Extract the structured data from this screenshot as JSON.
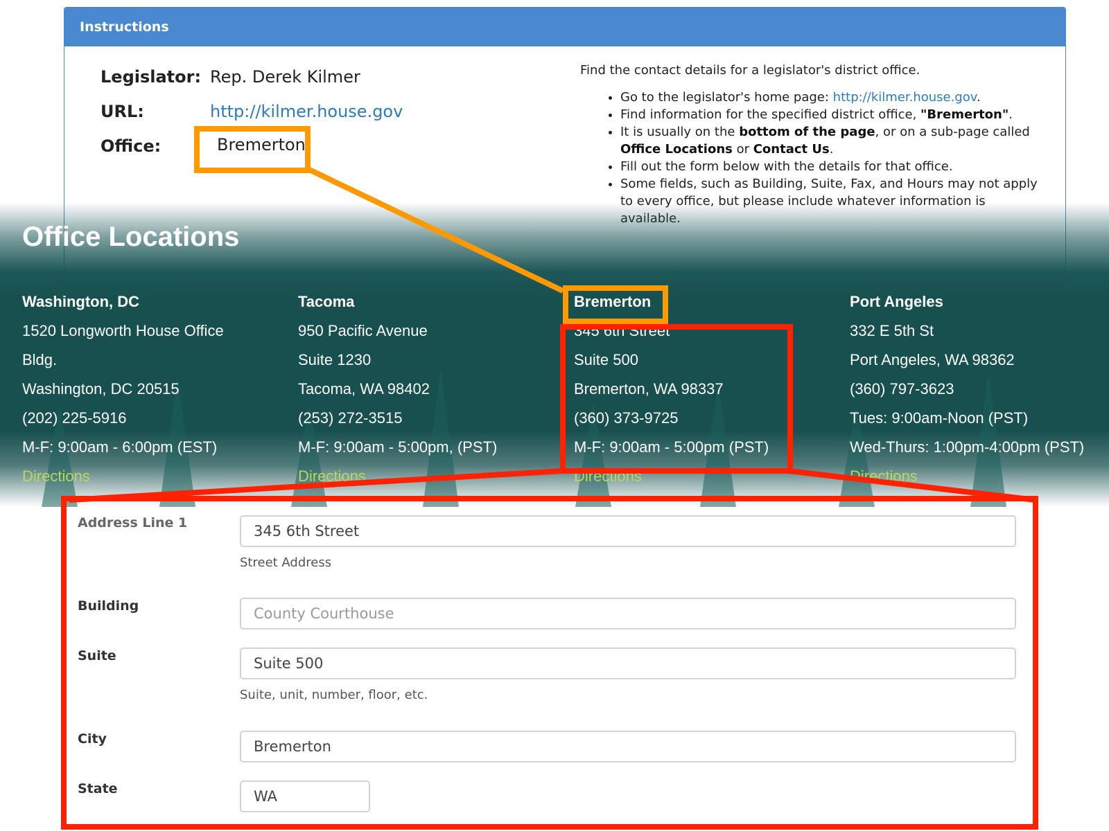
{
  "instructions": {
    "header": "Instructions",
    "legislator_label": "Legislator:",
    "legislator_value": "Rep. Derek Kilmer",
    "url_label": "URL:",
    "url_value": "http://kilmer.house.gov",
    "office_label": "Office:",
    "office_value": "Bremerton",
    "intro": "Find the contact details for a legislator's district office.",
    "bullets": {
      "b1_text": "Go to the legislator's home page: ",
      "b1_link": "http://kilmer.house.gov",
      "b1_end": ".",
      "b2_text": "Find information for the specified district office, ",
      "b2_bold": "\"Bremerton\"",
      "b2_end": ".",
      "b3_text": "It is usually on the ",
      "b3_bold1": "bottom of the page",
      "b3_mid": ", or on a sub-page called ",
      "b3_bold2": "Office Locations",
      "b3_or": " or ",
      "b3_bold3": "Contact Us",
      "b3_end": ".",
      "b4_text": "Fill out the form below with the details for that office.",
      "b5_text": "Some fields, such as Building, Suite, Fax, and Hours may not apply to every office, but please include whatever information is available."
    }
  },
  "office_locations": {
    "title": "Office Locations",
    "offices": [
      {
        "name": "Washington, DC",
        "line1": "1520 Longworth House Office",
        "line2": "Bldg.",
        "line3": "Washington, DC 20515",
        "line4": "(202) 225-5916",
        "line5": "M-F: 9:00am - 6:00pm (EST)",
        "directions": "Directions"
      },
      {
        "name": "Tacoma",
        "line1": "950 Pacific Avenue",
        "line2": "Suite 1230",
        "line3": "Tacoma, WA 98402",
        "line4": "(253) 272-3515",
        "line5": "M-F: 9:00am - 5:00pm, (PST)",
        "directions": "Directions"
      },
      {
        "name": "Bremerton",
        "line1": "345 6th Street",
        "line2": "Suite 500",
        "line3": "Bremerton, WA 98337",
        "line4": "(360) 373-9725",
        "line5": "M-F: 9:00am - 5:00pm (PST)",
        "directions": "Directions"
      },
      {
        "name": "Port Angeles",
        "line1": "332 E 5th St",
        "line2": "Port Angeles, WA 98362",
        "line3": "(360) 797-3623",
        "line4": "Tues: 9:00am-Noon (PST)",
        "line5": "Wed-Thurs: 1:00pm-4:00pm (PST)",
        "directions": "Directions"
      }
    ]
  },
  "form": {
    "address1_label": "Address Line 1",
    "address1_value": "345 6th Street",
    "address1_help": "Street Address",
    "building_label": "Building",
    "building_placeholder": "County Courthouse",
    "suite_label": "Suite",
    "suite_value": "Suite 500",
    "suite_help": "Suite, unit, number, floor, etc.",
    "city_label": "City",
    "city_value": "Bremerton",
    "state_label": "State",
    "state_value": "WA"
  },
  "colors": {
    "header_blue": "#4a89cf",
    "link_blue": "#2b7bc0",
    "band_teal": "#184f4f",
    "directions_green": "#b8d85a",
    "highlight_orange": "#ff9900",
    "highlight_red": "#ff2200"
  }
}
